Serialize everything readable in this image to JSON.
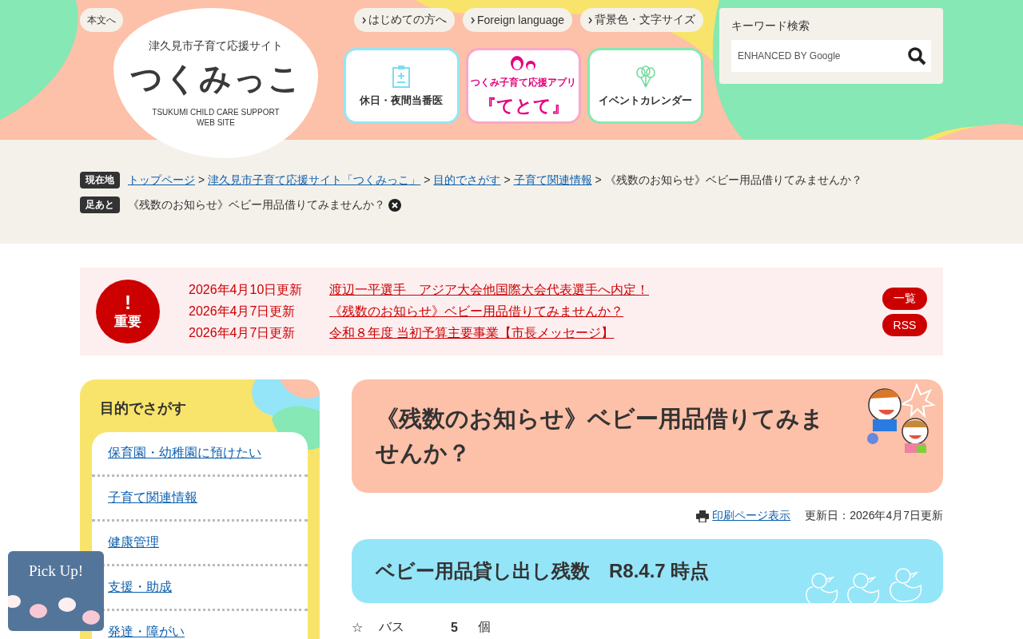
{
  "header": {
    "skip_link": "本文へ",
    "logo": {
      "tagline": "津久見市子育て応援サイト",
      "name": "つくみっこ",
      "english": "TSUKUMI CHILD CARE SUPPORT",
      "english_2": "WEB SITE"
    },
    "top_links": [
      "はじめての方へ",
      "Foreign language",
      "背景色・文字サイズ"
    ],
    "feature_buttons": [
      {
        "kind": "clinic",
        "label": "休日・夜間当番医"
      },
      {
        "kind": "app",
        "label": "つくみ子育て応援アプリ",
        "title": "『てとて』"
      },
      {
        "kind": "calendar",
        "label": "イベントカレンダー"
      }
    ],
    "search": {
      "label": "キーワード検索",
      "placeholder": "ENHANCED BY Google"
    }
  },
  "breadcrumb": {
    "label": "現在地",
    "separator": ">",
    "items": [
      {
        "text": "トップページ",
        "link": true
      },
      {
        "text": "津久見市子育て応援サイト「つくみっこ」",
        "link": true
      },
      {
        "text": "目的でさがす",
        "link": true
      },
      {
        "text": "子育て関連情報",
        "link": true
      },
      {
        "text": "《残数のお知らせ》ベビー用品借りてみませんか？",
        "link": false
      }
    ]
  },
  "footprint": {
    "label": "足あと",
    "items": [
      "《残数のお知らせ》ベビー用品借りてみませんか？"
    ]
  },
  "notice": {
    "badge_mark": "!",
    "badge_label": "重要",
    "items": [
      {
        "date": "2026年4月10日更新",
        "title": "渡辺一平選手　アジア大会他国際大会代表選手へ内定！"
      },
      {
        "date": "2026年4月7日更新",
        "title": "《残数のお知らせ》ベビー用品借りてみませんか？"
      },
      {
        "date": "2026年4月7日更新",
        "title": "令和８年度 当初予算主要事業【市長メッセージ】"
      }
    ],
    "buttons": [
      "一覧",
      "RSS"
    ]
  },
  "sidebar": {
    "title": "目的でさがす",
    "items": [
      "保育園・幼稚園に預けたい",
      "子育て関連情報",
      "健康管理",
      "支援・助成",
      "発達・障がい"
    ]
  },
  "article": {
    "title": "《残数のお知らせ》ベビー用品借りてみませんか？",
    "print_link": "印刷ページ表示",
    "updated": "更新日：2026年4月7日更新",
    "heading": "ベビー用品貸し出し残数　R8.4.7 時点",
    "rows": [
      {
        "mark": "☆",
        "item": "バス",
        "count": "5",
        "unit": "個"
      }
    ]
  },
  "pickup": {
    "label": "Pick Up!"
  }
}
